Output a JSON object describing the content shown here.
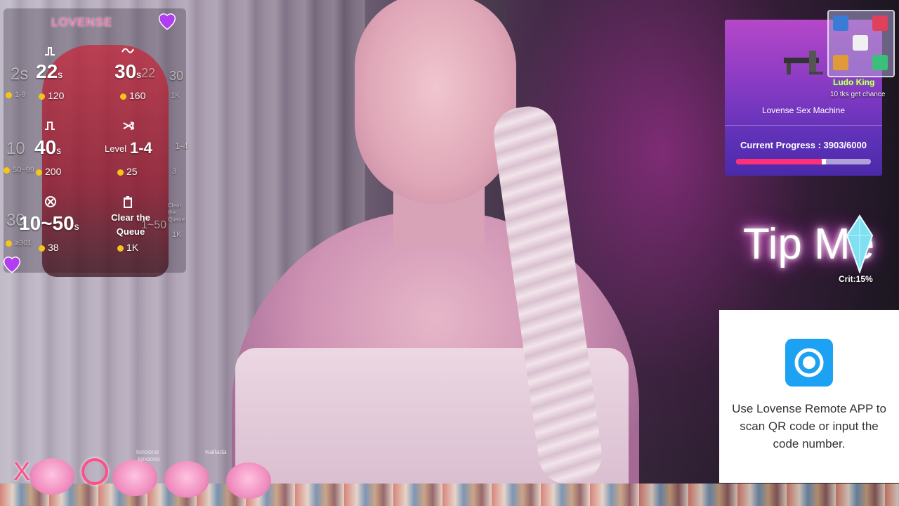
{
  "tip_menu": {
    "brand": "LOVENSE",
    "rows": [
      {
        "left_faded": "2s",
        "duration": "22",
        "unit": "s",
        "coin_left": "1-9",
        "tokens": "120",
        "right_duration": "30",
        "right_unit": "s",
        "right_faded": "22",
        "right_tokens": "160"
      },
      {
        "left_faded": "10",
        "duration": "40",
        "unit": "s",
        "coin_left": "50~99",
        "tokens": "200",
        "level_label": "Level",
        "level_value": "1-4",
        "right_tokens": "25"
      },
      {
        "left_faded": "30",
        "duration": "10~50",
        "unit": "s",
        "coin_left": "≥301",
        "tokens": "38",
        "right_label": "Clear the Queue",
        "right_tokens": "1K"
      }
    ],
    "faded_right_col": [
      "30",
      "1K",
      "1-4",
      "3",
      "Clear the Queue",
      "1~50",
      "1K"
    ]
  },
  "goal": {
    "title": "Lovense Sex Machine",
    "progress_label": "Current Progress : 3903/6000",
    "progress_fraction": 0.6505,
    "colors": {
      "bar": "#ff2f7a"
    }
  },
  "ludo": {
    "title": "Ludo King",
    "subtitle": "10 tks get chance"
  },
  "tip_me": {
    "text": "Tip Me",
    "crit": "Crit:15%"
  },
  "qr": {
    "message": "Use Lovense Remote APP to scan QR code or input the code number."
  },
  "bottom": {
    "x_symbol": "X",
    "chat_names": [
      "lonoono",
      "lonoono",
      "wallada"
    ]
  }
}
